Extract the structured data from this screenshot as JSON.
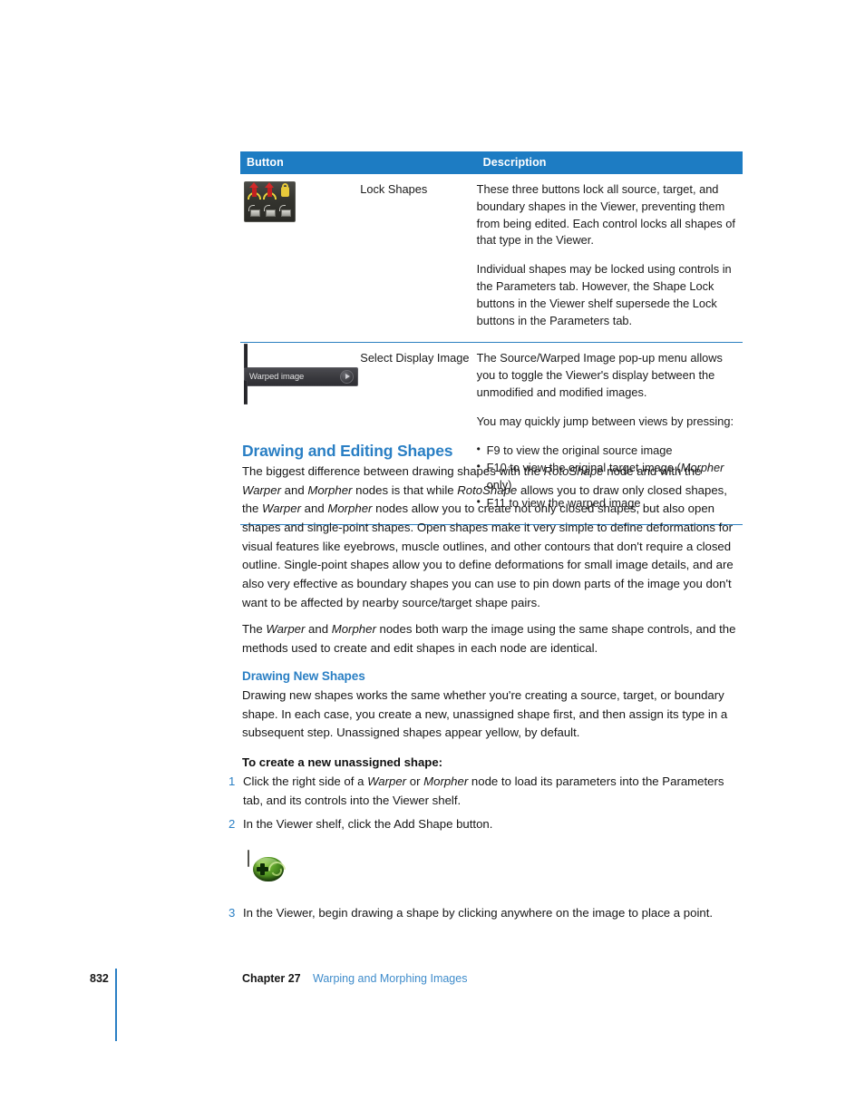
{
  "table": {
    "headers": {
      "button": "Button",
      "description": "Description"
    },
    "rows": [
      {
        "icon_name": "lock-shapes-icon",
        "name": "Lock Shapes",
        "paragraphs": [
          "These three buttons lock all source, target, and boundary shapes in the Viewer, preventing them from being edited. Each control locks all shapes of that type in the Viewer.",
          "Individual shapes may be locked using controls in the Parameters tab. However, the Shape Lock buttons in the Viewer shelf supersede the Lock buttons in the Parameters tab."
        ]
      },
      {
        "icon_name": "select-display-image-popup",
        "icon_label": "Warped image",
        "name": "Select Display Image",
        "paragraphs": [
          "The Source/Warped Image pop-up menu allows you to toggle the Viewer's display between the unmodified and modified images.",
          "You may quickly jump between views by pressing:"
        ],
        "bullets": [
          "F9 to view the original source image",
          "F10 to view the original target image (Morpher only)",
          "F11 to view the warped image"
        ]
      }
    ]
  },
  "headings": {
    "section": "Drawing and Editing Shapes",
    "subsection": "Drawing New Shapes",
    "procedure": "To create a new unassigned shape:"
  },
  "body": {
    "para_1_a": "The biggest difference between drawing shapes with the ",
    "para_1_b": "RotoShape",
    "para_1_c": " node and with the ",
    "para_1_d": "Warper",
    "para_1_e": " and ",
    "para_1_f": "Morpher",
    "para_1_g": " nodes is that while ",
    "para_1_h": "RotoShape",
    "para_1_i": " allows you to draw only closed shapes, the ",
    "para_1_j": "Warper",
    "para_1_k": " and ",
    "para_1_l": "Morpher",
    "para_1_m": " nodes allow you to create not only closed shapes, but also open shapes and single-point shapes. Open shapes make it very simple to define deformations for visual features like eyebrows, muscle outlines, and other contours that don't require a closed outline. Single-point shapes allow you to define deformations for small image details, and are also very effective as boundary shapes you can use to pin down parts of the image you don't want to be affected by nearby source/target shape pairs.",
    "para_2_a": "The ",
    "para_2_b": "Warper",
    "para_2_c": " and ",
    "para_2_d": "Morpher",
    "para_2_e": " nodes both warp the image using the same shape controls, and the methods used to create and edit shapes in each node are identical.",
    "para_3": "Drawing new shapes works the same whether you're creating a source, target, or boundary shape. In each case, you create a new, unassigned shape first, and then assign its type in a subsequent step. Unassigned shapes appear yellow, by default."
  },
  "steps": [
    {
      "num": "1",
      "a": "Click the right side of a ",
      "b": "Warper",
      "c": " or ",
      "d": "Morpher",
      "e": " node to load its parameters into the Parameters tab, and its controls into the Viewer shelf."
    },
    {
      "num": "2",
      "a": "In the Viewer shelf, click the Add Shape button.",
      "b": "",
      "c": "",
      "d": "",
      "e": ""
    },
    {
      "num": "3",
      "a": "In the Viewer, begin drawing a shape by clicking anywhere on the image to place a point.",
      "b": "",
      "c": "",
      "d": "",
      "e": ""
    }
  ],
  "add_shape_icon_name": "add-shape-icon",
  "footer": {
    "page_number": "832",
    "chapter": "Chapter 27",
    "title": "Warping and Morphing Images"
  },
  "colors": {
    "table_header_bg": "#1d7cc3",
    "rule": "#2a7fc0",
    "heading_blue": "#2a7fc4",
    "link_blue": "#3f8ccb"
  }
}
